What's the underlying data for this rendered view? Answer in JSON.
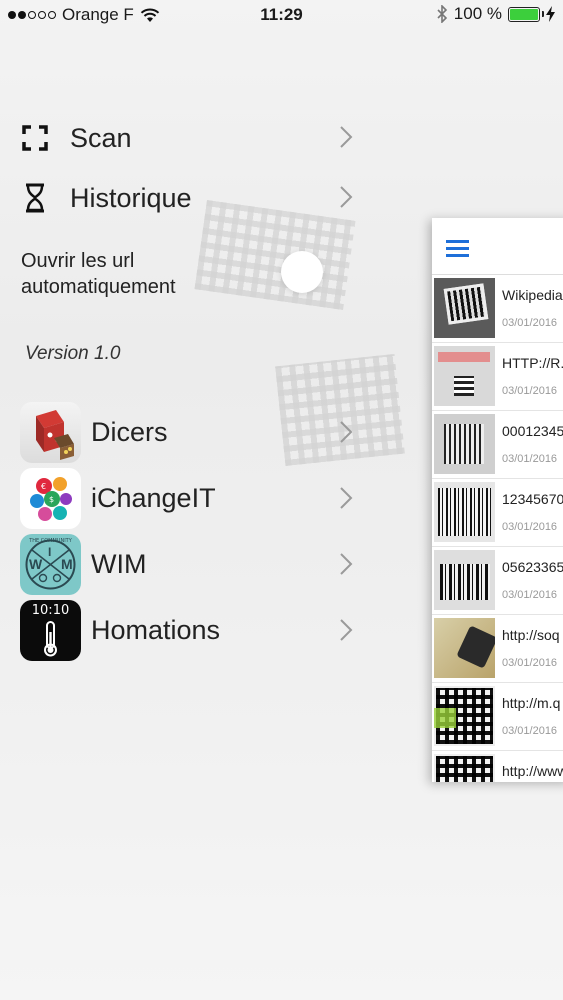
{
  "status_bar": {
    "carrier": "Orange F",
    "time": "11:29",
    "battery_pct": "100 %",
    "signal_bars": 2,
    "battery_color": "#3ccf3c"
  },
  "menu": {
    "items": [
      {
        "label": "Scan",
        "icon": "scan-frame-icon"
      },
      {
        "label": "Historique",
        "icon": "hourglass-icon"
      }
    ],
    "auto_open_label_1": "Ouvrir les url",
    "auto_open_label_2": "automatiquement",
    "version": "Version 1.0"
  },
  "apps": [
    {
      "label": "Dicers",
      "icon": "dicers-app-icon"
    },
    {
      "label": "iChangeIT",
      "icon": "ichangeit-app-icon"
    },
    {
      "label": "WIM",
      "icon": "wim-app-icon",
      "icon_text": "THE COMMUNITY",
      "letters": [
        "W",
        "I",
        "M"
      ]
    },
    {
      "label": "Homations",
      "icon": "homations-app-icon",
      "icon_text": "10:10"
    }
  ],
  "history": {
    "items": [
      {
        "title": "Wikipedia",
        "date": "03/01/2016"
      },
      {
        "title": "HTTP://R.",
        "date": "03/01/2016"
      },
      {
        "title": "00012345",
        "date": "03/01/2016"
      },
      {
        "title": "12345670",
        "date": "03/01/2016"
      },
      {
        "title": "05623365",
        "date": "03/01/2016"
      },
      {
        "title": "http://soq",
        "date": "03/01/2016"
      },
      {
        "title": "http://m.q",
        "date": "03/01/2016"
      },
      {
        "title": "http://www",
        "date": ""
      }
    ]
  },
  "colors": {
    "accent": "#1e6fd9"
  }
}
